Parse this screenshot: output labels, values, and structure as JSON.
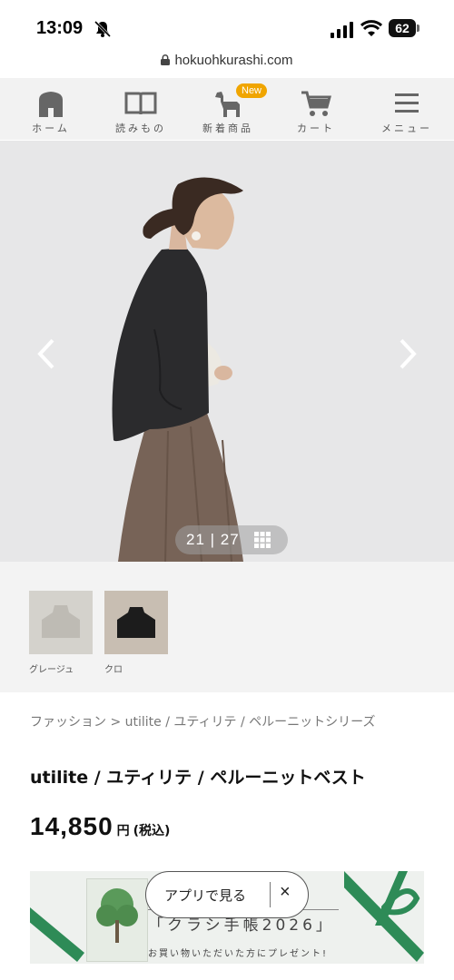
{
  "status": {
    "time": "13:09",
    "battery": "62"
  },
  "browser": {
    "url": "hokuohkurashi.com"
  },
  "nav": {
    "items": [
      {
        "label": "ホーム",
        "icon": "home-icon"
      },
      {
        "label": "読みもの",
        "icon": "book-icon"
      },
      {
        "label": "新着商品",
        "icon": "horse-icon",
        "badge": "New"
      },
      {
        "label": "カート",
        "icon": "cart-icon"
      },
      {
        "label": "メニュー",
        "icon": "menu-icon"
      }
    ]
  },
  "gallery": {
    "counter": "21 | 27",
    "current": 21,
    "total": 27
  },
  "variants": [
    {
      "label": "グレージュ"
    },
    {
      "label": "クロ"
    }
  ],
  "breadcrumb": "ファッション > utilite / ユティリテ / ペルーニットシリーズ",
  "product": {
    "title": "utilite / ユティリテ / ペルーニットベスト",
    "price": "14,850",
    "currency": "円",
    "tax_note": "(税込)"
  },
  "banner": {
    "title": "「クラシ手帳2026」",
    "subtitle": "お買い物いただいた方にプレゼント!"
  },
  "app_prompt": {
    "label": "アプリで見る",
    "close": "×"
  },
  "colors": {
    "nav_bg": "#f2f2f2",
    "icon_gray": "#666666",
    "badge": "#f0a500",
    "banner_green": "#2e8b57"
  }
}
